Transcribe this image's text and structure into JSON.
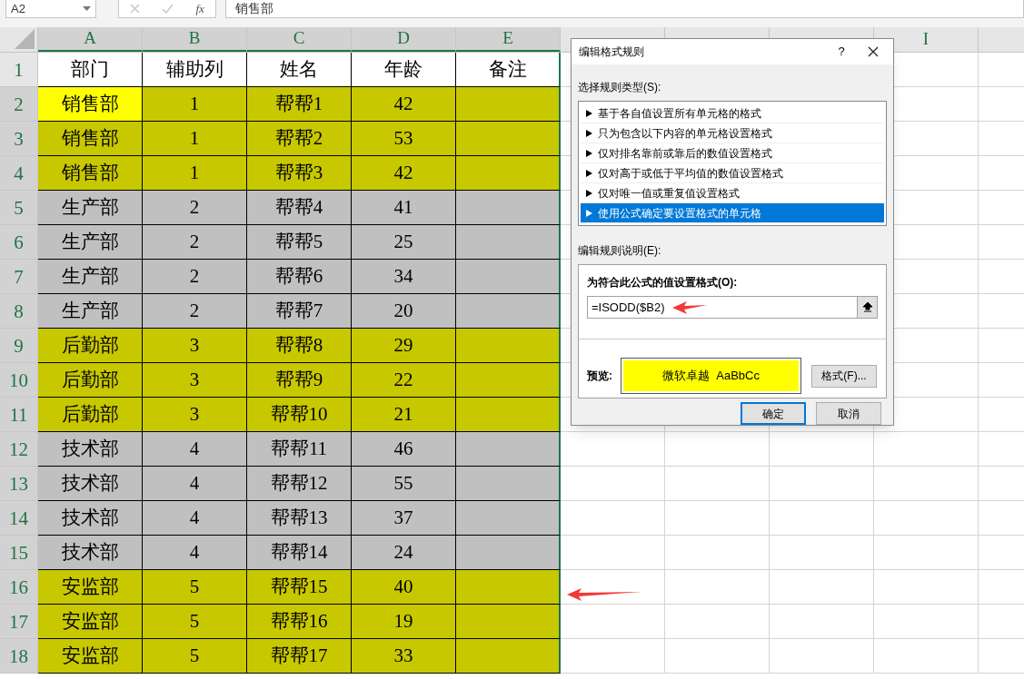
{
  "formula_bar": {
    "name_box": "A2",
    "function_label": "fx",
    "value": "销售部"
  },
  "columns": [
    "A",
    "B",
    "C",
    "D",
    "E",
    "I"
  ],
  "header_row": {
    "number": "1",
    "cells": [
      "部门",
      "辅助列",
      "姓名",
      "年龄",
      "备注"
    ]
  },
  "rows": [
    {
      "number": "2",
      "cells": [
        "销售部",
        "1",
        "帮帮1",
        "42"
      ],
      "color": "#c8c800",
      "selected": true
    },
    {
      "number": "3",
      "cells": [
        "销售部",
        "1",
        "帮帮2",
        "53"
      ],
      "color": "#c8c800",
      "selected": false
    },
    {
      "number": "4",
      "cells": [
        "销售部",
        "1",
        "帮帮3",
        "42"
      ],
      "color": "#c8c800",
      "selected": false
    },
    {
      "number": "5",
      "cells": [
        "生产部",
        "2",
        "帮帮4",
        "41"
      ],
      "color": "#c0c0c0",
      "selected": false
    },
    {
      "number": "6",
      "cells": [
        "生产部",
        "2",
        "帮帮5",
        "25"
      ],
      "color": "#c0c0c0",
      "selected": false
    },
    {
      "number": "7",
      "cells": [
        "生产部",
        "2",
        "帮帮6",
        "34"
      ],
      "color": "#c0c0c0",
      "selected": false
    },
    {
      "number": "8",
      "cells": [
        "生产部",
        "2",
        "帮帮7",
        "20"
      ],
      "color": "#c0c0c0",
      "selected": false
    },
    {
      "number": "9",
      "cells": [
        "后勤部",
        "3",
        "帮帮8",
        "29"
      ],
      "color": "#c8c800",
      "selected": false
    },
    {
      "number": "10",
      "cells": [
        "后勤部",
        "3",
        "帮帮9",
        "22"
      ],
      "color": "#c8c800",
      "selected": false
    },
    {
      "number": "11",
      "cells": [
        "后勤部",
        "3",
        "帮帮10",
        "21"
      ],
      "color": "#c8c800",
      "selected": false
    },
    {
      "number": "12",
      "cells": [
        "技术部",
        "4",
        "帮帮11",
        "46"
      ],
      "color": "#c0c0c0",
      "selected": false
    },
    {
      "number": "13",
      "cells": [
        "技术部",
        "4",
        "帮帮12",
        "55"
      ],
      "color": "#c0c0c0",
      "selected": false
    },
    {
      "number": "14",
      "cells": [
        "技术部",
        "4",
        "帮帮13",
        "37"
      ],
      "color": "#c0c0c0",
      "selected": false
    },
    {
      "number": "15",
      "cells": [
        "技术部",
        "4",
        "帮帮14",
        "24"
      ],
      "color": "#c0c0c0",
      "selected": false
    },
    {
      "number": "16",
      "cells": [
        "安监部",
        "5",
        "帮帮15",
        "40"
      ],
      "color": "#c8c800",
      "selected": false
    },
    {
      "number": "17",
      "cells": [
        "安监部",
        "5",
        "帮帮16",
        "19"
      ],
      "color": "#c8c800",
      "selected": false
    },
    {
      "number": "18",
      "cells": [
        "安监部",
        "5",
        "帮帮17",
        "33"
      ],
      "color": "#c8c800",
      "selected": false
    }
  ],
  "dialog": {
    "title": "编辑格式规则",
    "help": "?",
    "rule_type_label": "选择规则类型(S):",
    "rule_types": [
      {
        "label": "基于各自值设置所有单元格的格式",
        "selected": false
      },
      {
        "label": "只为包含以下内容的单元格设置格式",
        "selected": false
      },
      {
        "label": "仅对排名靠前或靠后的数值设置格式",
        "selected": false
      },
      {
        "label": "仅对高于或低于平均值的数值设置格式",
        "selected": false
      },
      {
        "label": "仅对唯一值或重复值设置格式",
        "selected": false
      },
      {
        "label": "使用公式确定要设置格式的单元格",
        "selected": true
      }
    ],
    "description_label": "编辑规则说明(E):",
    "formula_label": "为符合此公式的值设置格式(O):",
    "formula": "=ISODD($B2)",
    "preview_label": "预览:",
    "preview_text": "微软卓越  AaBbCc",
    "format_button": "格式(F)...",
    "ok_button": "确定",
    "cancel_button": "取消"
  }
}
